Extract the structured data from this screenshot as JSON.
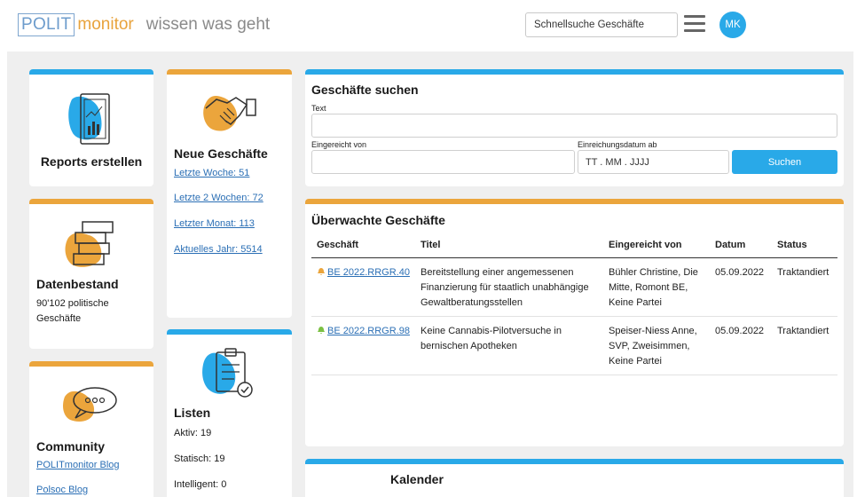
{
  "header": {
    "logo_box": "POLIT",
    "logo_rest": "monitor",
    "claim": "wissen was geht",
    "search_placeholder": "Schnellsuche Geschäfte",
    "avatar": "MK"
  },
  "reports": {
    "title": "Reports erstellen"
  },
  "datenbestand": {
    "title": "Datenbestand",
    "text": "90'102 politische Geschäfte"
  },
  "community": {
    "title": "Community",
    "links": [
      "POLITmonitor Blog",
      "Polsoc Blog"
    ]
  },
  "neue": {
    "title": "Neue Geschäfte",
    "links": [
      "Letzte Woche: 51",
      "Letzte 2 Wochen: 72",
      "Letzter Monat: 113",
      "Aktuelles Jahr: 5514"
    ]
  },
  "listen": {
    "title": "Listen",
    "items": [
      "Aktiv: 19",
      "Statisch: 19",
      "Intelligent: 0"
    ]
  },
  "suche": {
    "title": "Geschäfte suchen",
    "text_label": "Text",
    "von_label": "Eingereicht von",
    "datum_label": "Einreichungsdatum ab",
    "datum_placeholder": "TT . MM . JJJJ",
    "button": "Suchen"
  },
  "ueberwacht": {
    "title": "Überwachte Geschäfte",
    "columns": [
      "Geschäft",
      "Titel",
      "Eingereicht von",
      "Datum",
      "Status"
    ],
    "rows": [
      {
        "geschaeft": "BE 2022.RRGR.40",
        "bell_color": "#eba53c",
        "titel": "Bereitstellung einer angemessenen Finanzierung für staatlich unabhängige Gewaltberatungsstellen",
        "von": "Bühler Christine, Die Mitte, Romont BE, Keine Partei",
        "datum": "05.09.2022",
        "status": "Traktandiert"
      },
      {
        "geschaeft": "BE 2022.RRGR.98",
        "bell_color": "#7bc043",
        "titel": "Keine Cannabis-Pilotversuche in bernischen Apotheken",
        "von": "Speiser-Niess Anne, SVP, Zweisimmen, Keine Partei",
        "datum": "05.09.2022",
        "status": "Traktandiert"
      }
    ]
  },
  "kalender": {
    "title": "Kalender"
  },
  "colors": {
    "blue": "#29a9e8",
    "orange": "#eba53c",
    "link": "#2b6fb5"
  }
}
